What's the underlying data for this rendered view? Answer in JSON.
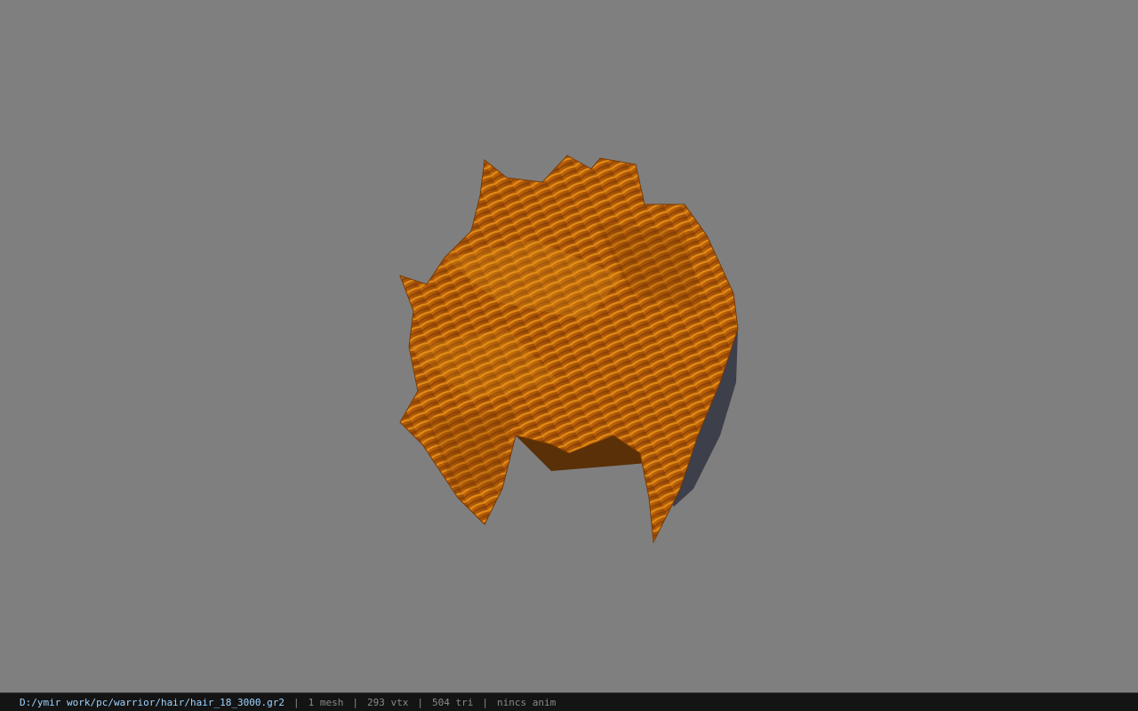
{
  "viewer": {
    "background_color": "#7f7f7f",
    "model_icon": "hair-mesh-icon",
    "model_colors": {
      "hair_base": "#b35a08",
      "hair_highlight": "#e89a1a",
      "hair_shadow": "#7a3a04",
      "underside": "#3d3f4a"
    }
  },
  "statusbar": {
    "file_path": "D:/ymir work/pc/warrior/hair/hair_18_3000.gr2",
    "separator": "|",
    "mesh_count": "1 mesh",
    "vertex_count": "293 vtx",
    "triangle_count": "504 tri",
    "anim_status": "nincs anim"
  }
}
